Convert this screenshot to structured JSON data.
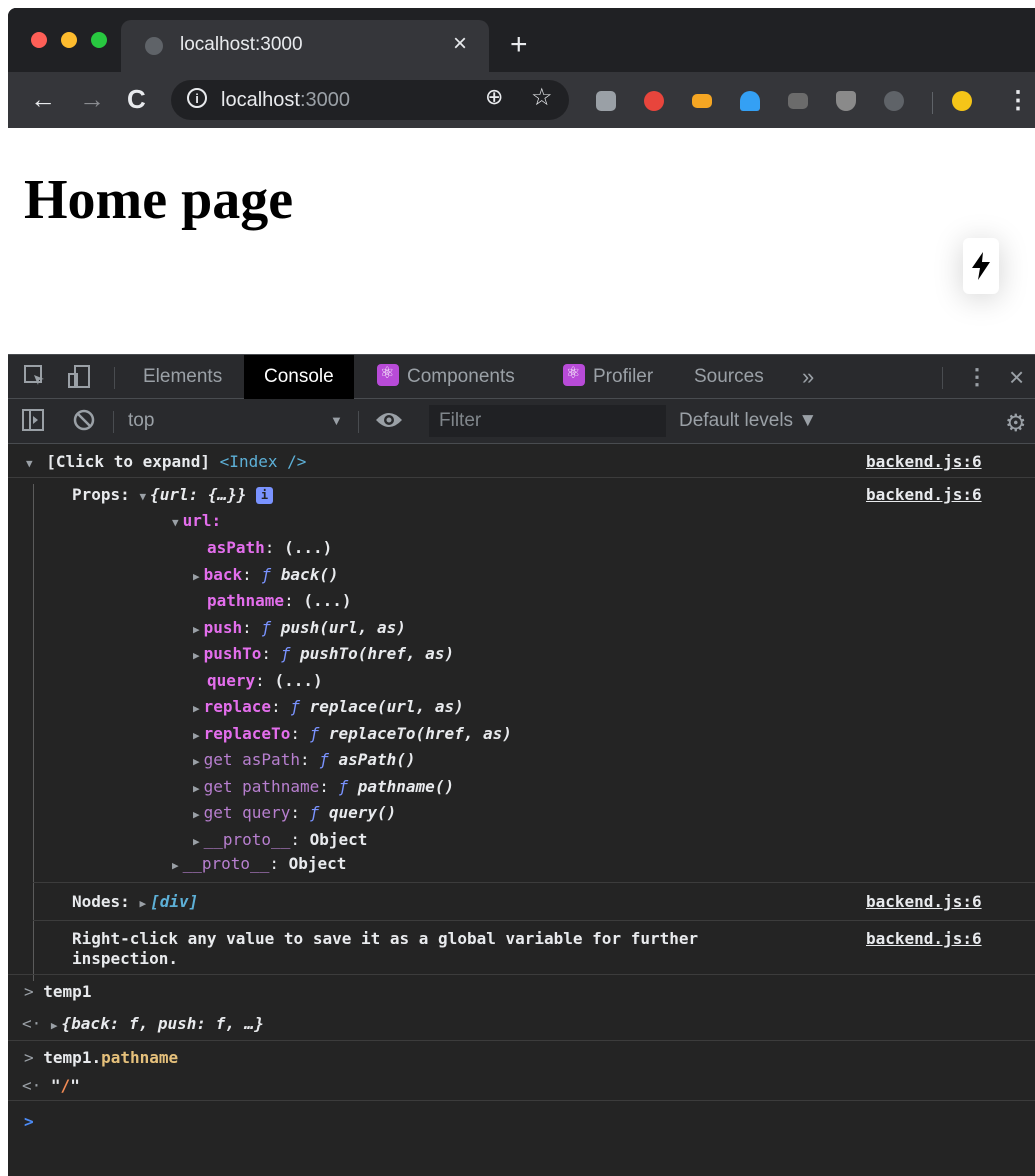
{
  "browser": {
    "tab_title": "localhost:3000",
    "tab_close": "×",
    "new_tab": "+",
    "url_host": "localhost",
    "url_port": ":3000",
    "extensions": [
      {
        "name": "pocket-extension",
        "color": "#9aa0a6"
      },
      {
        "name": "shield-extension",
        "color": "#e8453c"
      },
      {
        "name": "wallet-extension",
        "color": "#f5a623"
      },
      {
        "name": "ghostery-extension",
        "color": "#34a0f4"
      },
      {
        "name": "chip-extension",
        "color": "#6b6b6b"
      },
      {
        "name": "ublock-extension",
        "color": "#8a8a8a"
      },
      {
        "name": "info-extension",
        "color": "#5f6368"
      }
    ]
  },
  "page": {
    "heading": "Home page"
  },
  "devtools": {
    "tabs": [
      "Elements",
      "Console",
      "Components",
      "Profiler",
      "Sources"
    ],
    "active_tab": "Console",
    "more": "»",
    "context": "top",
    "filter_placeholder": "Filter",
    "levels": "Default levels ▼"
  },
  "console": {
    "group_header": "[Click to expand]",
    "group_component": "<Index />",
    "source": "backend.js:6",
    "props_label": "Props:",
    "props_preview": "{url: {…}}",
    "url_key": "url:",
    "tree": [
      {
        "k": "asPath",
        "v": "(...)",
        "type": "getter",
        "expand": false
      },
      {
        "k": "back",
        "v": "back()",
        "type": "fn",
        "expand": true
      },
      {
        "k": "pathname",
        "v": "(...)",
        "type": "getter",
        "expand": false
      },
      {
        "k": "push",
        "v": "push(url, as)",
        "type": "fn",
        "expand": true
      },
      {
        "k": "pushTo",
        "v": "pushTo(href, as)",
        "type": "fn",
        "expand": true
      },
      {
        "k": "query",
        "v": "(...)",
        "type": "getter",
        "expand": false
      },
      {
        "k": "replace",
        "v": "replace(url, as)",
        "type": "fn",
        "expand": true
      },
      {
        "k": "replaceTo",
        "v": "replaceTo(href, as)",
        "type": "fn",
        "expand": true
      },
      {
        "k": "get asPath",
        "v": "asPath()",
        "type": "fn-dim",
        "expand": true
      },
      {
        "k": "get pathname",
        "v": "pathname()",
        "type": "fn-dim",
        "expand": true
      },
      {
        "k": "get query",
        "v": "query()",
        "type": "fn-dim",
        "expand": true
      },
      {
        "k": "__proto__",
        "v": "Object",
        "type": "proto",
        "expand": true
      }
    ],
    "url_proto_key": "__proto__",
    "url_proto_val": "Object",
    "nodes_label": "Nodes:",
    "nodes_value": "[div]",
    "hint_line1": "Right-click any value to save it as a global variable for further",
    "hint_line2": "inspection.",
    "cmd1": "temp1",
    "result1": "{back: f, push: f, …}",
    "cmd2_obj": "temp1.",
    "cmd2_prop": "pathname",
    "result2_q1": "\"",
    "result2_slash": "/",
    "result2_q2": "\""
  }
}
